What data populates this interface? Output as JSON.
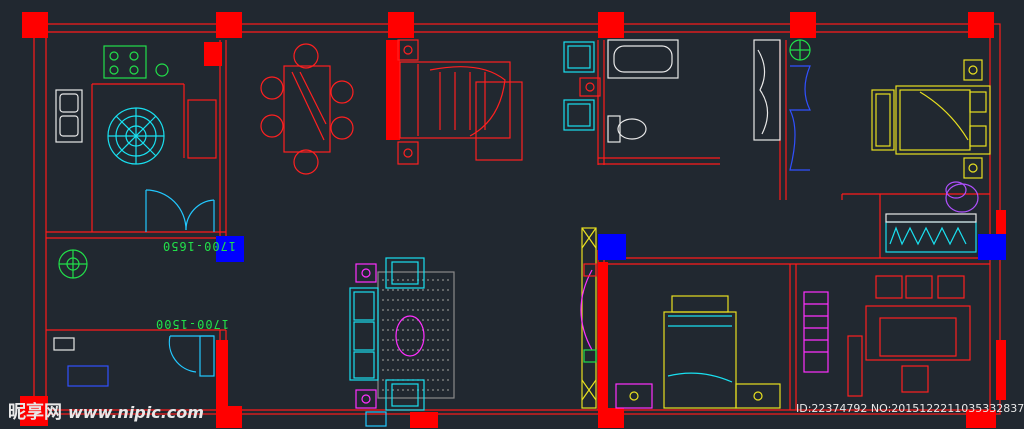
{
  "dimension_labels": [
    "1700-1650",
    "1700-1500"
  ],
  "watermark": {
    "site_name": "昵享网",
    "url": "www.nipic.com",
    "id_text": "ID:22374792 NO:20151222110353328373"
  },
  "colors": {
    "background": "#212830",
    "wall": "#ff1a1a",
    "column": "#ff0000",
    "column_blue": "#0000ff",
    "furniture_red": "#ff2020",
    "furniture_cyan": "#19e0f0",
    "furniture_yellow": "#e8e020",
    "furniture_magenta": "#ff30ff",
    "furniture_white": "#e8e8e8",
    "plant_green": "#22e04a",
    "door_cyan": "#22c8ff",
    "accent_blue": "#3050ff"
  }
}
